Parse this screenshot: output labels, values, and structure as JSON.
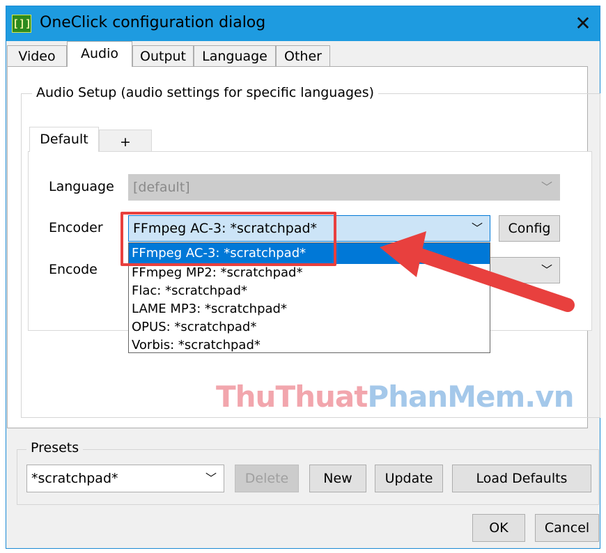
{
  "window": {
    "title": "OneClick configuration dialog",
    "icon_glyph": "[]]",
    "close_glyph": "✕"
  },
  "tabs": [
    {
      "label": "Video",
      "active": false
    },
    {
      "label": "Audio",
      "active": true
    },
    {
      "label": "Output",
      "active": false
    },
    {
      "label": "Language",
      "active": false
    },
    {
      "label": "Other",
      "active": false
    }
  ],
  "audio_setup": {
    "group_title": "Audio Setup (audio settings for specific languages)",
    "inner_tabs": [
      {
        "label": "Default",
        "active": true
      },
      {
        "label": "+",
        "active": false
      }
    ],
    "language": {
      "label": "Language",
      "value": "[default]",
      "enabled": false
    },
    "encoder": {
      "label": "Encoder",
      "value": "FFmpeg AC-3: *scratchpad*",
      "config_button": "Config",
      "options": [
        "FFmpeg AC-3: *scratchpad*",
        "FFmpeg MP2: *scratchpad*",
        "Flac: *scratchpad*",
        "LAME MP3: *scratchpad*",
        "OPUS: *scratchpad*",
        "Vorbis: *scratchpad*"
      ],
      "highlighted_index": 0
    },
    "encode": {
      "label": "Encode"
    }
  },
  "watermark": {
    "part1": "ThuThuat",
    "part2": "PhanMem",
    "part3": ".vn"
  },
  "presets": {
    "group_title": "Presets",
    "value": "*scratchpad*",
    "buttons": {
      "delete": "Delete",
      "new": "New",
      "update": "Update",
      "load_defaults": "Load Defaults"
    }
  },
  "dialog_buttons": {
    "ok": "OK",
    "cancel": "Cancel"
  },
  "icons": {
    "dropdown_arrow": "chevron-down-icon",
    "close": "close-icon",
    "annotation": "red-arrow-icon"
  },
  "colors": {
    "titlebar": "#1e9be0",
    "selection": "#0078d7",
    "annotation_red": "#e8403e"
  }
}
